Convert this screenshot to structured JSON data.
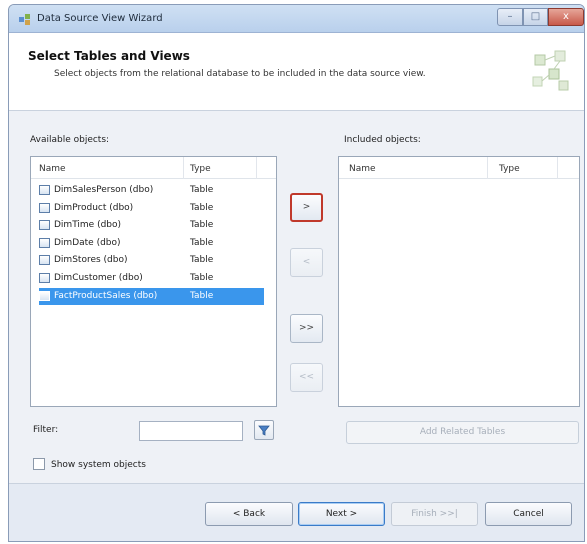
{
  "window": {
    "title": "Data Source View Wizard",
    "min_label": "–",
    "max_label": "□",
    "close_label": "x"
  },
  "header": {
    "title": "Select Tables and Views",
    "subtitle": "Select objects from the relational database to be included in the data source view."
  },
  "available": {
    "label": "Available objects:",
    "col_name": "Name",
    "col_type": "Type",
    "rows": [
      {
        "name": "DimSalesPerson (dbo)",
        "type": "Table",
        "selected": false
      },
      {
        "name": "DimProduct (dbo)",
        "type": "Table",
        "selected": false
      },
      {
        "name": "DimTime (dbo)",
        "type": "Table",
        "selected": false
      },
      {
        "name": "DimDate (dbo)",
        "type": "Table",
        "selected": false
      },
      {
        "name": "DimStores (dbo)",
        "type": "Table",
        "selected": false
      },
      {
        "name": "DimCustomer (dbo)",
        "type": "Table",
        "selected": false
      },
      {
        "name": "FactProductSales (dbo)",
        "type": "Table",
        "selected": true
      }
    ]
  },
  "included": {
    "label": "Included objects:",
    "col_name": "Name",
    "col_type": "Type"
  },
  "move": {
    "add": ">",
    "remove": "<",
    "add_all": ">>",
    "remove_all": "<<"
  },
  "filter": {
    "label": "Filter:",
    "value": "",
    "icon": "filter-funnel-icon"
  },
  "add_related_label": "Add Related Tables",
  "show_system": {
    "label": "Show system objects",
    "checked": false
  },
  "footer": {
    "back": "< Back",
    "next": "Next >",
    "finish": "Finish >>|",
    "cancel": "Cancel"
  },
  "colors": {
    "selection": "#3a96ec",
    "focus_border": "#c0392b",
    "title_bar": "#c3d8f0"
  }
}
